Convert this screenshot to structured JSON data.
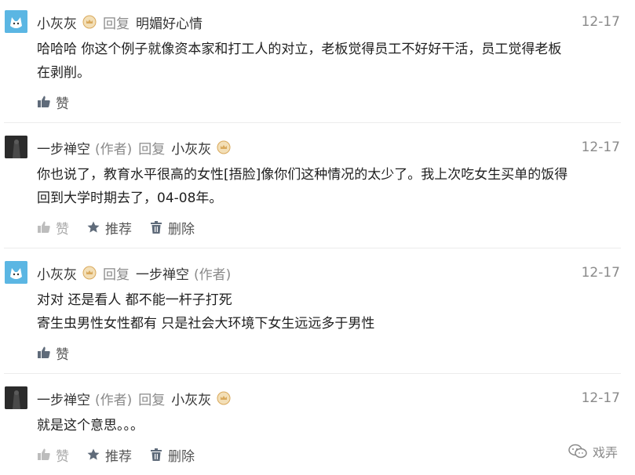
{
  "comments": [
    {
      "author": "小灰灰",
      "author_tag": "",
      "reply_label": "回复",
      "reply_to": "明媚好心情",
      "reply_to_tag": "",
      "time": "12-17",
      "lines": [
        "哈哈哈 你这个例子就像资本家和打工人的对立，老板觉得员工不好好干活，员工觉得老板",
        "在剥削。"
      ],
      "actions": [
        {
          "label": "赞",
          "icon": "thumbs-up-icon"
        }
      ]
    },
    {
      "author": "一步禅空",
      "author_tag": "(作者)",
      "reply_label": "回复",
      "reply_to": "小灰灰",
      "reply_to_tag": "",
      "time": "12-17",
      "lines": [
        "你也说了，教育水平很高的女性[捂脸]像你们这种情况的太少了。我上次吃女生买单的饭得",
        "回到大学时期去了，04-08年。"
      ],
      "actions": [
        {
          "label": "赞",
          "icon": "thumbs-up-icon"
        },
        {
          "label": "推荐",
          "icon": "star-icon"
        },
        {
          "label": "删除",
          "icon": "trash-icon"
        }
      ]
    },
    {
      "author": "小灰灰",
      "author_tag": "",
      "reply_label": "回复",
      "reply_to": "一步禅空",
      "reply_to_tag": "(作者)",
      "time": "12-17",
      "lines": [
        "对对 还是看人 都不能一杆子打死",
        "寄生虫男性女性都有 只是社会大环境下女生远远多于男性"
      ],
      "actions": [
        {
          "label": "赞",
          "icon": "thumbs-up-icon"
        }
      ]
    },
    {
      "author": "一步禅空",
      "author_tag": "(作者)",
      "reply_label": "回复",
      "reply_to": "小灰灰",
      "reply_to_tag": "",
      "time": "12-17",
      "lines": [
        "就是这个意思。。。"
      ],
      "actions": [
        {
          "label": "赞",
          "icon": "thumbs-up-icon"
        },
        {
          "label": "推荐",
          "icon": "star-icon"
        },
        {
          "label": "删除",
          "icon": "trash-icon"
        }
      ]
    }
  ],
  "watermark": {
    "text": "戏弄",
    "icon": "wechat-icon"
  },
  "colors": {
    "text": "#1f1f1f",
    "meta": "#8a8a8a",
    "badge": "#e0a84b",
    "divider": "#ececec"
  }
}
